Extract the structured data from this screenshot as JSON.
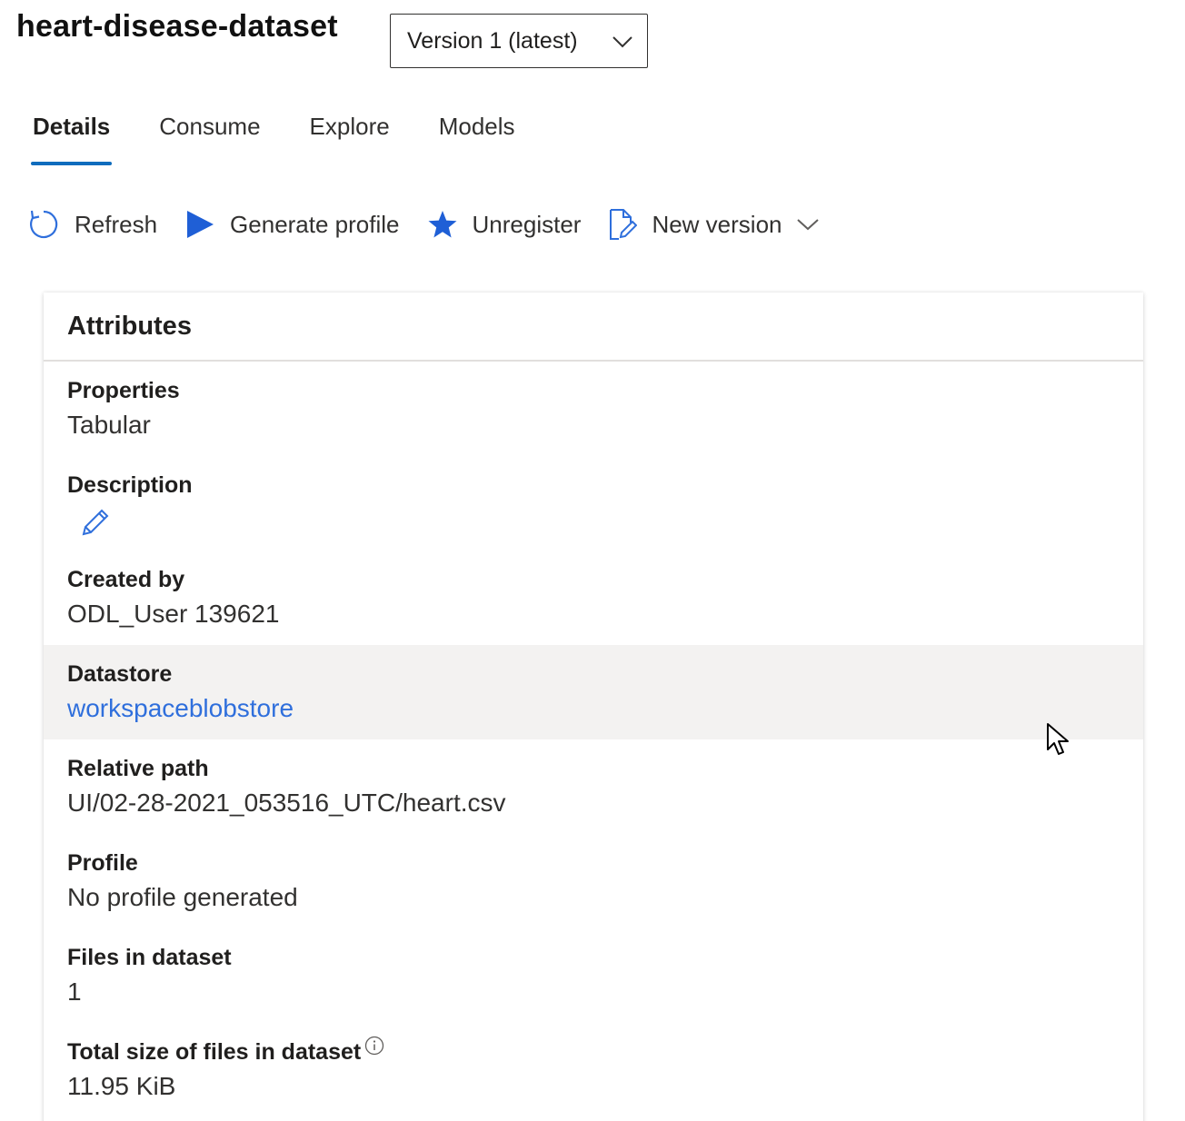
{
  "header": {
    "title": "heart-disease-dataset",
    "version_select": "Version 1 (latest)"
  },
  "tabs": [
    {
      "label": "Details",
      "active": true
    },
    {
      "label": "Consume",
      "active": false
    },
    {
      "label": "Explore",
      "active": false
    },
    {
      "label": "Models",
      "active": false
    }
  ],
  "toolbar": {
    "refresh": "Refresh",
    "generate_profile": "Generate profile",
    "unregister": "Unregister",
    "new_version": "New version"
  },
  "attributes": {
    "title": "Attributes",
    "properties_label": "Properties",
    "properties_value": "Tabular",
    "description_label": "Description",
    "created_by_label": "Created by",
    "created_by_value": "ODL_User 139621",
    "datastore_label": "Datastore",
    "datastore_value": "workspaceblobstore",
    "relative_path_label": "Relative path",
    "relative_path_value": "UI/02-28-2021_053516_UTC/heart.csv",
    "profile_label": "Profile",
    "profile_value": "No profile generated",
    "files_label": "Files in dataset",
    "files_value": "1",
    "total_size_label": "Total size of files in dataset",
    "total_size_value": "11.95 KiB"
  },
  "colors": {
    "accent": "#0f6cbd",
    "link": "#2f6fdc",
    "highlight_row": "#f3f2f1"
  },
  "icons": [
    "chevron-down-icon",
    "refresh-icon",
    "play-icon",
    "star-icon",
    "new-version-icon",
    "edit-icon",
    "info-icon",
    "mouse-cursor-icon"
  ]
}
